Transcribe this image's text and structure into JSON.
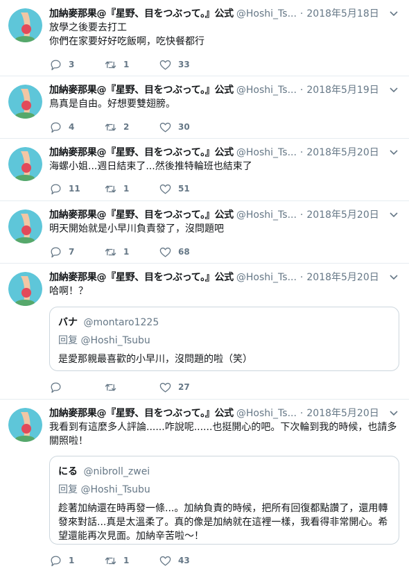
{
  "account": {
    "name": "加納麥那果@『星野、目をつぶって。』公式",
    "handle": "@Hoshi_Ts...",
    "separator": "·"
  },
  "tweets": [
    {
      "date": "2018年5月18日",
      "text": "放學之後要去打工\n你們在家要好好吃飯啊，吃快餐都行",
      "replies": "3",
      "retweets": "1",
      "likes": "33"
    },
    {
      "date": "2018年5月19日",
      "text": "鳥真是自由。好想要雙翅膀。",
      "replies": "4",
      "retweets": "2",
      "likes": "30"
    },
    {
      "date": "2018年5月20日",
      "text": "海螺小姐...週日結束了...然後推特輪班也結束了",
      "replies": "11",
      "retweets": "1",
      "likes": "51"
    },
    {
      "date": "2018年5月20日",
      "text": "明天開始就是小早川負責發了，沒問題吧",
      "replies": "7",
      "retweets": "1",
      "likes": "68"
    },
    {
      "date": "2018年5月20日",
      "text": "哈啊！？",
      "replies": "",
      "retweets": "",
      "likes": "27",
      "quote": {
        "name": "バナ",
        "handle": "@montaro1225",
        "reply_to": "回复 @Hoshi_Tsubu",
        "text": "是愛那親最喜歡的小早川，沒問題的啦（笑）"
      }
    },
    {
      "date": "2018年5月20日",
      "text": "我看到有這麼多人評論......咋說呢......也挺開心的吧。下次輪到我的時候，也請多關照啦！",
      "replies": "1",
      "retweets": "1",
      "likes": "43",
      "quote": {
        "name": "にる",
        "handle": "@nibroll_zwei",
        "reply_to": "回复 @Hoshi_Tsubu",
        "text": "趁著加納還在時再發一條...。加納負責的時候，把所有回復都點讚了，還用轉發來對話...真是太溫柔了。真的像是加納就在這裡一樣，我看得非常開心。希望還能再次見面。加納辛苦啦～！"
      }
    }
  ],
  "icons": {
    "reply": "reply-icon",
    "retweet": "retweet-icon",
    "like": "heart-icon",
    "menu": "chevron-down-icon"
  },
  "colors": {
    "text": "#14171a",
    "muted": "#657786",
    "border": "#e6ecf0",
    "quote_border": "#ccd6dd"
  }
}
